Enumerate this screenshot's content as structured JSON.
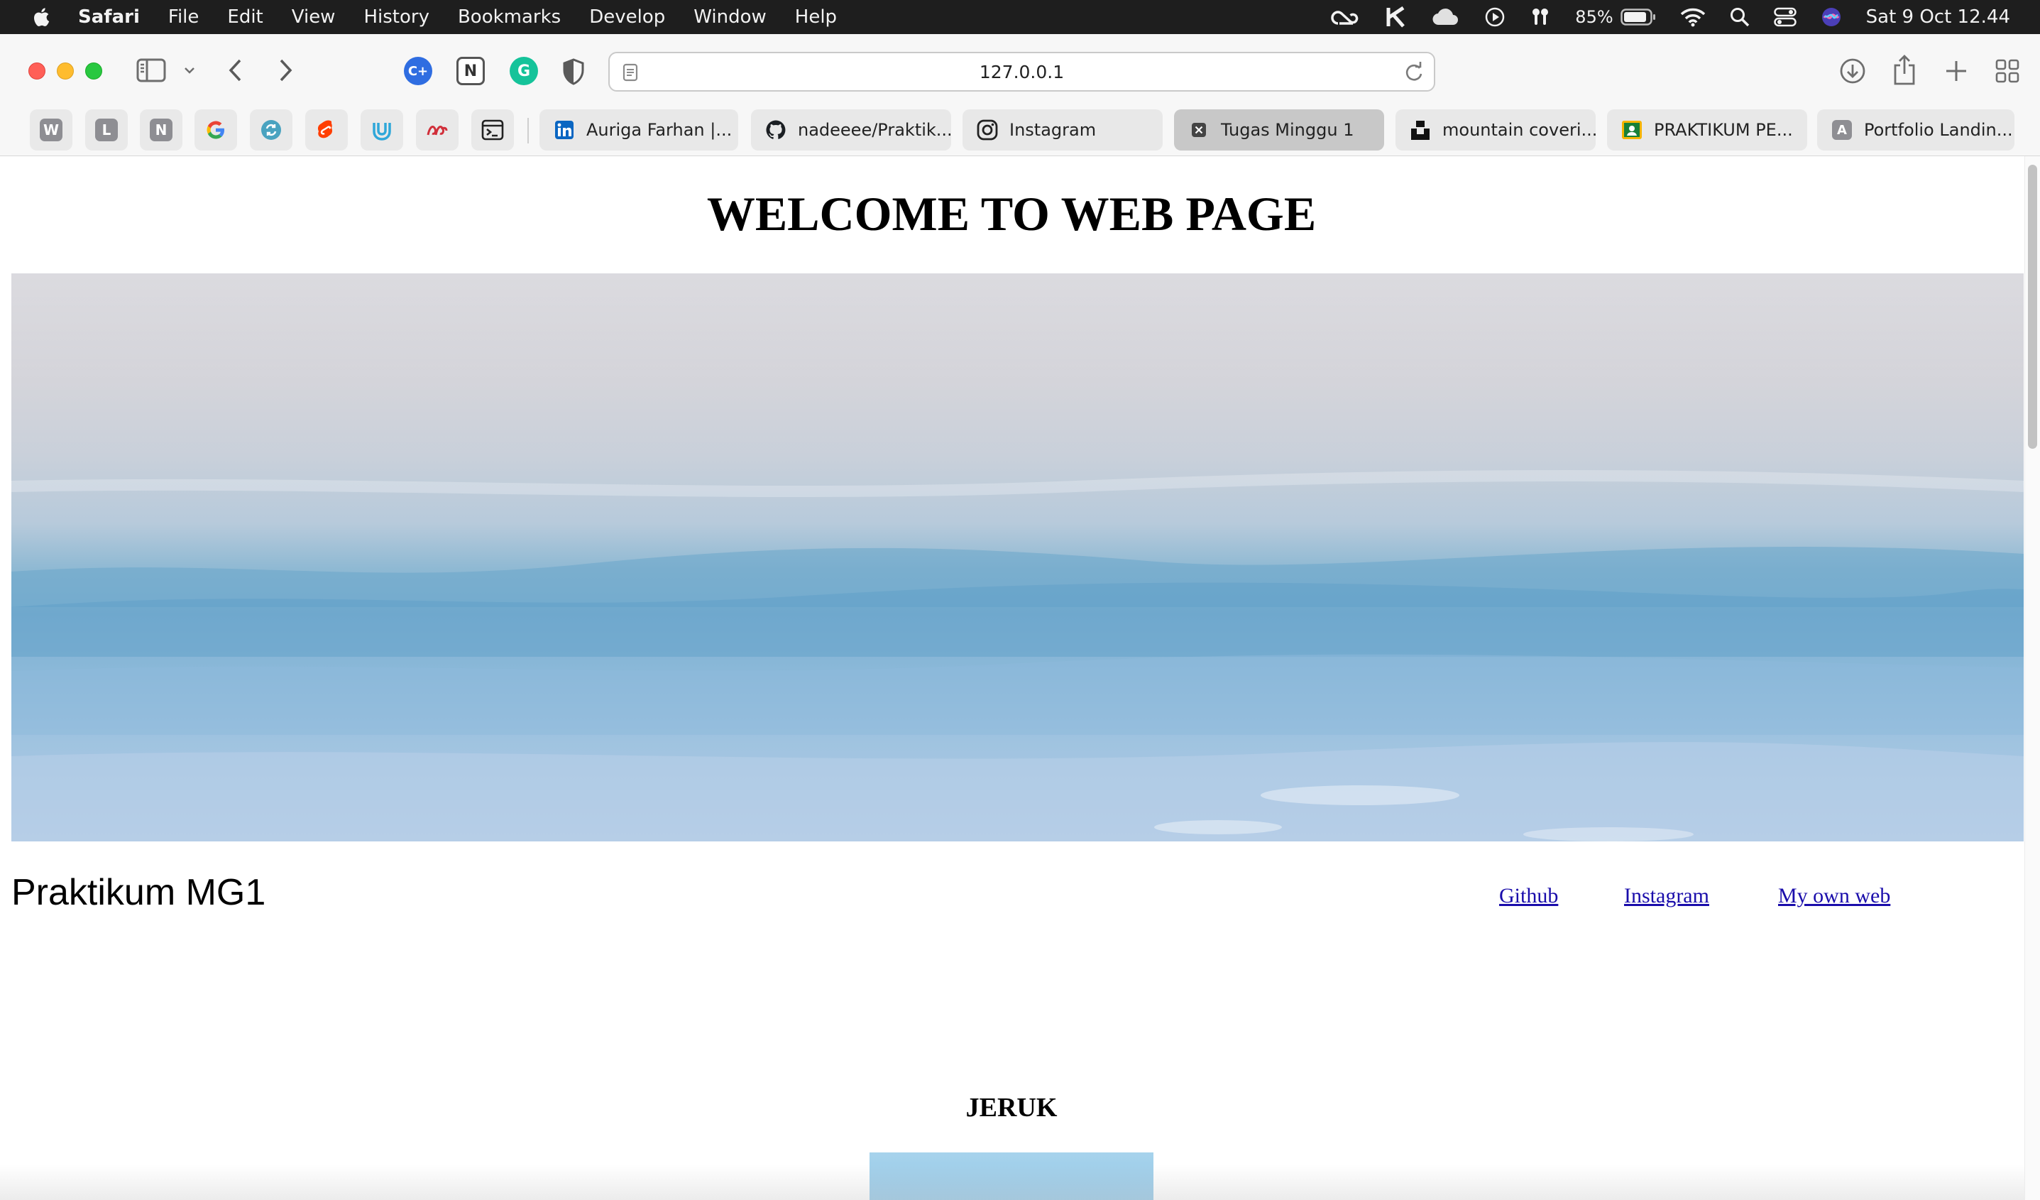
{
  "menubar": {
    "apple_icon": "apple-icon",
    "app_name": "Safari",
    "items": [
      "File",
      "Edit",
      "View",
      "History",
      "Bookmarks",
      "Develop",
      "Window",
      "Help"
    ],
    "battery_percent": "85%",
    "clock": "Sat 9 Oct  12.44"
  },
  "toolbar": {
    "url": "127.0.0.1",
    "icons": [
      "sidebar-icon",
      "chevron-down-icon",
      "back-icon",
      "forward-icon",
      "download-icon",
      "share-icon",
      "new-tab-icon",
      "tab-overview-icon"
    ],
    "extensions": [
      "C+",
      "N",
      "G",
      "shield"
    ]
  },
  "favorites": {
    "letters": [
      "W",
      "L",
      "N"
    ],
    "icons": [
      "google-icon",
      "sync-icon",
      "svelte-icon",
      "udemy-icon",
      "web-icon",
      "terminal-icon"
    ]
  },
  "tabs": [
    {
      "label": "Auriga Farhan |...",
      "icon": "linkedin-icon"
    },
    {
      "label": "nadeeee/Praktik...",
      "icon": "github-icon"
    },
    {
      "label": "Instagram",
      "icon": "instagram-icon"
    },
    {
      "label": "Tugas Minggu 1",
      "icon": "close-icon",
      "active": true
    },
    {
      "label": "mountain coveri...",
      "icon": "unsplash-icon"
    },
    {
      "label": "PRAKTIKUM PE...",
      "icon": "classroom-icon"
    },
    {
      "label": "Portfolio Landin...",
      "icon": "a-letter-icon"
    }
  ],
  "page": {
    "heading": "WELCOME TO WEB PAGE",
    "site_title": "Praktikum MG1",
    "links": [
      "Github",
      "Instagram",
      "My own web"
    ],
    "section_title": "JERUK"
  }
}
